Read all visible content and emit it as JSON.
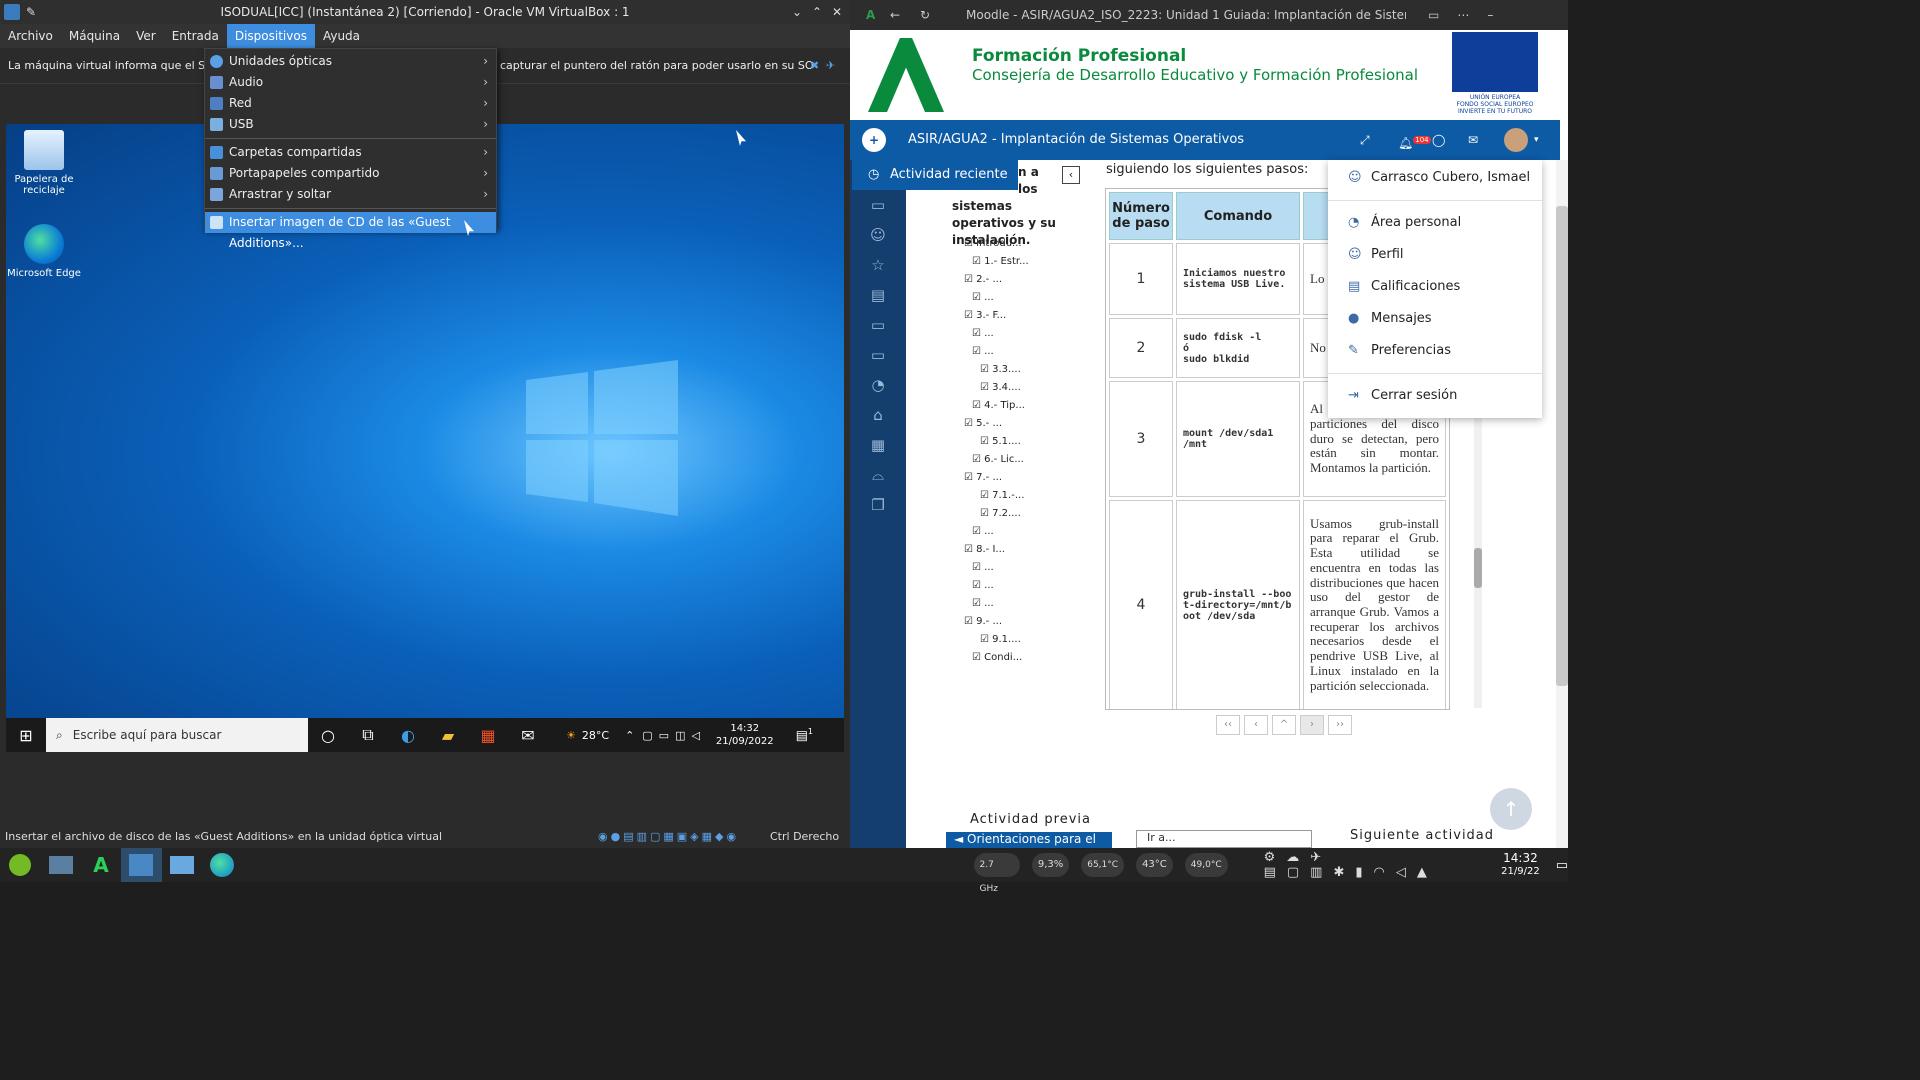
{
  "vbox": {
    "title": "ISODUAL[ICC] (Instantánea 2) [Corriendo] - Oracle VM VirtualBox : 1",
    "menu": [
      "Archivo",
      "Máquina",
      "Ver",
      "Entrada",
      "Dispositivos",
      "Ayuda"
    ],
    "notice": "La máquina virtual informa que el SO invitado",
    "notice_tail": "capturar el puntero del ratón para poder usarlo en su SO invitado",
    "status": "Insertar el archivo de disco de las «Guest Additions» en la unidad óptica virtual",
    "host_key": "Ctrl Derecho"
  },
  "dev_menu": {
    "items": [
      {
        "label": "Unidades ópticas",
        "icon": "optical-disc-icon",
        "submenu": true,
        "color": "#5aa0e6"
      },
      {
        "label": "Audio",
        "icon": "audio-icon",
        "submenu": true,
        "color": "#6a8fd0"
      },
      {
        "label": "Red",
        "icon": "network-icon",
        "submenu": true,
        "color": "#4d7fc2"
      },
      {
        "label": "USB",
        "icon": "usb-icon",
        "submenu": true,
        "color": "#7ab0e0"
      }
    ],
    "items2": [
      {
        "label": "Carpetas compartidas",
        "icon": "shared-folder-icon",
        "submenu": true,
        "color": "#4a90d9"
      },
      {
        "label": "Portapapeles compartido",
        "icon": "clipboard-icon",
        "submenu": true,
        "color": "#6a9ad6"
      },
      {
        "label": "Arrastrar y soltar",
        "icon": "drag-drop-icon",
        "submenu": true,
        "color": "#7aa6dc"
      }
    ],
    "selected": "Insertar imagen de CD de las «Guest Additions»..."
  },
  "windows": {
    "icons": [
      "Papelera de reciclaje",
      "Microsoft Edge"
    ],
    "search": "Escribe aquí para buscar",
    "weather": "28°C",
    "time": "14:32",
    "date": "21/09/2022",
    "notif": "1"
  },
  "browser": {
    "title": "Moodle - ASIR/AGUA2_ISO_2223: Unidad 1 Guiada: Implantación de Sistemas Operativos",
    "fp_title": "Formación Profesional",
    "fp_subtitle": "Consejería de Desarrollo Educativo y Formación Profesional",
    "eu_text": "UNIÓN EUROPEA\nFONDO SOCIAL EUROPEO\nINVIERTE EN TU FUTURO",
    "course": "ASIR/AGUA2 - Implantación de Sistemas Operativos",
    "notif_count": "104",
    "recent": "Actividad reciente",
    "toc_head": [
      "n a los",
      "sistemas",
      "operativos y su",
      "instalación."
    ],
    "toc": [
      "Introdu...",
      "1.- Estr...",
      "2.- ...",
      "...",
      "3.- F...",
      "...",
      "...",
      "3.3....",
      "3.4....",
      "4.- Tip...",
      "5.- ...",
      "5.1....",
      "6.- Lic...",
      "7.- ...",
      "7.1.-...",
      "7.2....",
      "...",
      "8.- I...",
      "...",
      "...",
      "...",
      "9.- ...",
      "9.1....",
      "Condi..."
    ],
    "intro": "siguiendo los siguientes pasos:",
    "headers": [
      "Número de paso",
      "Comando"
    ],
    "rows": [
      {
        "n": "1",
        "cmd": "Iniciamos nuestro sistema USB Live.",
        "desc": "Lo pro ins ter"
      },
      {
        "n": "2",
        "cmd": "sudo fdisk -l\nó\nsudo blkdid",
        "desc": "No info par"
      },
      {
        "n": "3",
        "cmd": "mount /dev/sda1 /mnt",
        "desc": "Al má Live, las particiones del disco duro se detectan, pero están sin montar. Montamos la partición."
      },
      {
        "n": "4",
        "cmd": "grub-install --boot-directory=/mnt/boot /dev/sda",
        "desc": "Usamos grub-install para reparar el Grub. Esta utilidad se encuentra en todas las distribuciones que hacen uso del gestor de arranque Grub. Vamos a recuperar los archivos necesarios desde el pendrive USB Live, al Linux instalado en la partición seleccionada."
      }
    ],
    "pager": [
      "‹‹",
      "‹",
      "^",
      "›",
      "››"
    ],
    "prev_activity": "Actividad previa",
    "prev_link": "◄ Orientaciones para el",
    "goto": "Ir a...",
    "next_activity": "Siguiente actividad",
    "user_menu": [
      {
        "label": "Carrasco Cubero, Ismael",
        "icon": "user-icon"
      },
      {
        "label": "Área personal",
        "icon": "dashboard-icon"
      },
      {
        "label": "Perfil",
        "icon": "profile-icon"
      },
      {
        "label": "Calificaciones",
        "icon": "grades-icon"
      },
      {
        "label": "Mensajes",
        "icon": "messages-icon"
      },
      {
        "label": "Preferencias",
        "icon": "preferences-icon"
      },
      {
        "label": "Cerrar sesión",
        "icon": "logout-icon"
      }
    ]
  },
  "host": {
    "cpu_freq": "2.7 GHz",
    "cpu": "9,3%",
    "cpu_temp": "65,1°C",
    "temp2": "43°C",
    "temp3": "49,0°C",
    "time": "14:32",
    "date": "21/9/22"
  }
}
